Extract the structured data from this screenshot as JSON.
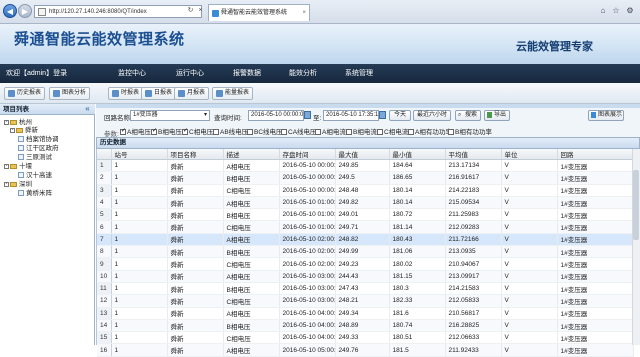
{
  "browser": {
    "url": "http://120.27.140.246:8080/QT/index",
    "tab_title": "舜通智能云能效管理系统",
    "back_icon": "arrow-left-icon",
    "forward_icon": "arrow-right-icon"
  },
  "header": {
    "title": "舜通智能云能效管理系统",
    "slogan": "云能效管理专家",
    "welcome": "欢迎【admin】登录",
    "menu": [
      "监控中心",
      "运行中心",
      "报警数据",
      "能效分析",
      "系统管理"
    ]
  },
  "toolbar": {
    "buttons": [
      "历史报表",
      "图表分析",
      "时报表",
      "日报表",
      "月报表",
      "能量报表"
    ]
  },
  "left_panel": {
    "title": "项目列表",
    "collapse_icon": "double-chevron-left-icon",
    "tree": {
      "hangzhou": "杭州",
      "shuntong": "舜新",
      "archive": "档案馆协调",
      "jiangqu": "江干区政府",
      "sanyuan": "三原测试",
      "shiyan": "十堰",
      "hanshi": "汉十高速",
      "shenzhen": "深圳",
      "huangqiao": "黄桥米阵"
    }
  },
  "filters": {
    "loop_label": "回路名称:",
    "loop_value": "1#变压器",
    "query_time_label": "查询时间:",
    "start_time": "2016-05-10 00:00:00",
    "to_label": "至:",
    "end_time": "2016-05-10 17:35:18",
    "today": "今天",
    "last_6h": "最近六小时",
    "search": "搜索",
    "export": "导出",
    "chart_display": "图表展示",
    "param_label": "参数:",
    "params": [
      {
        "label": "A相电压",
        "checked": true
      },
      {
        "label": "B相电压",
        "checked": true
      },
      {
        "label": "C相电压",
        "checked": true
      },
      {
        "label": "AB线电压",
        "checked": false
      },
      {
        "label": "BC线电压",
        "checked": false
      },
      {
        "label": "CA线电压",
        "checked": false
      },
      {
        "label": "A相电流",
        "checked": false
      },
      {
        "label": "B相电流",
        "checked": false
      },
      {
        "label": "C相电流",
        "checked": false
      },
      {
        "label": "A相有功功率",
        "checked": false
      },
      {
        "label": "B相有功功率",
        "checked": false
      }
    ]
  },
  "grid": {
    "title": "历史数据",
    "columns": [
      "站号",
      "项目名称",
      "描述",
      "存盘时间",
      "最大值",
      "最小值",
      "平均值",
      "单位",
      "回路"
    ],
    "rows": [
      {
        "n": "1",
        "station": "1",
        "project": "舜新",
        "desc": "A相电压",
        "time": "2016-05-10 00:00:00",
        "max": "249.85",
        "min": "184.64",
        "avg": "213.17134",
        "unit": "V",
        "loop": "1#变压器"
      },
      {
        "n": "2",
        "station": "1",
        "project": "舜新",
        "desc": "B相电压",
        "time": "2016-05-10 00:00:00",
        "max": "249.5",
        "min": "186.65",
        "avg": "216.91617",
        "unit": "V",
        "loop": "1#变压器"
      },
      {
        "n": "3",
        "station": "1",
        "project": "舜新",
        "desc": "C相电压",
        "time": "2016-05-10 00:00:00",
        "max": "248.48",
        "min": "180.14",
        "avg": "214.22183",
        "unit": "V",
        "loop": "1#变压器"
      },
      {
        "n": "4",
        "station": "1",
        "project": "舜新",
        "desc": "A相电压",
        "time": "2016-05-10 01:00:00",
        "max": "249.82",
        "min": "180.14",
        "avg": "215.09534",
        "unit": "V",
        "loop": "1#变压器"
      },
      {
        "n": "5",
        "station": "1",
        "project": "舜新",
        "desc": "B相电压",
        "time": "2016-05-10 01:00:00",
        "max": "249.01",
        "min": "180.72",
        "avg": "211.25983",
        "unit": "V",
        "loop": "1#变压器"
      },
      {
        "n": "6",
        "station": "1",
        "project": "舜新",
        "desc": "C相电压",
        "time": "2016-05-10 01:00:00",
        "max": "249.71",
        "min": "181.14",
        "avg": "212.09283",
        "unit": "V",
        "loop": "1#变压器"
      },
      {
        "n": "7",
        "station": "1",
        "project": "舜新",
        "desc": "A相电压",
        "time": "2016-05-10 02:00:00",
        "max": "248.82",
        "min": "180.43",
        "avg": "211.72166",
        "unit": "V",
        "loop": "1#变压器"
      },
      {
        "n": "8",
        "station": "1",
        "project": "舜新",
        "desc": "B相电压",
        "time": "2016-05-10 02:00:00",
        "max": "249.99",
        "min": "181.06",
        "avg": "213.0935",
        "unit": "V",
        "loop": "1#变压器"
      },
      {
        "n": "9",
        "station": "1",
        "project": "舜新",
        "desc": "C相电压",
        "time": "2016-05-10 02:00:00",
        "max": "249.23",
        "min": "180.02",
        "avg": "210.94067",
        "unit": "V",
        "loop": "1#变压器"
      },
      {
        "n": "10",
        "station": "1",
        "project": "舜新",
        "desc": "A相电压",
        "time": "2016-05-10 03:00:00",
        "max": "244.43",
        "min": "181.15",
        "avg": "213.09917",
        "unit": "V",
        "loop": "1#变压器"
      },
      {
        "n": "11",
        "station": "1",
        "project": "舜新",
        "desc": "B相电压",
        "time": "2016-05-10 03:00:00",
        "max": "247.43",
        "min": "180.3",
        "avg": "214.21583",
        "unit": "V",
        "loop": "1#变压器"
      },
      {
        "n": "12",
        "station": "1",
        "project": "舜新",
        "desc": "C相电压",
        "time": "2016-05-10 03:00:00",
        "max": "248.21",
        "min": "182.33",
        "avg": "212.05833",
        "unit": "V",
        "loop": "1#变压器"
      },
      {
        "n": "13",
        "station": "1",
        "project": "舜新",
        "desc": "A相电压",
        "time": "2016-05-10 04:00:00",
        "max": "249.34",
        "min": "181.6",
        "avg": "210.56817",
        "unit": "V",
        "loop": "1#变压器"
      },
      {
        "n": "14",
        "station": "1",
        "project": "舜新",
        "desc": "B相电压",
        "time": "2016-05-10 04:00:00",
        "max": "248.89",
        "min": "180.74",
        "avg": "216.28825",
        "unit": "V",
        "loop": "1#变压器"
      },
      {
        "n": "15",
        "station": "1",
        "project": "舜新",
        "desc": "C相电压",
        "time": "2016-05-10 04:00:00",
        "max": "249.33",
        "min": "180.51",
        "avg": "212.06633",
        "unit": "V",
        "loop": "1#变压器"
      },
      {
        "n": "16",
        "station": "1",
        "project": "舜新",
        "desc": "A相电压",
        "time": "2016-05-10 05:00:00",
        "max": "249.76",
        "min": "181.5",
        "avg": "211.92433",
        "unit": "V",
        "loop": "1#变压器"
      }
    ]
  }
}
